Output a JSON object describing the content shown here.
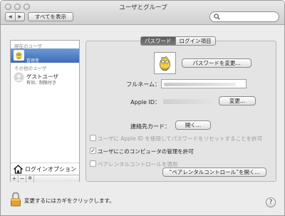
{
  "window": {
    "title": "ユーザとグループ"
  },
  "toolbar": {
    "back_glyph": "◀",
    "forward_glyph": "▶",
    "show_all_label": "すべてを表示",
    "search_value": ""
  },
  "sidebar": {
    "current_users_header": "現在のユーザ",
    "current_user": {
      "name": "",
      "role": "管理者"
    },
    "other_users_header": "その他のユーザ",
    "guest_user": {
      "name": "ゲストユーザ",
      "status": "有効、制限付き"
    },
    "login_options_label": "ログインオプション",
    "add_glyph": "+",
    "remove_glyph": "−",
    "action_glyph": "✲"
  },
  "tabs": [
    {
      "label": "パスワード",
      "active": true
    },
    {
      "label": "ログイン項目",
      "active": false
    }
  ],
  "password_pane": {
    "change_password_label": "パスワードを変更...",
    "full_name_label": "フルネーム：",
    "full_name_value": "",
    "apple_id_label": "Apple ID：",
    "apple_id_value": "",
    "apple_id_change_label": "変更...",
    "contact_card_label": "連絡先カード：",
    "contact_card_open_label": "開く...",
    "options": [
      {
        "label": "ユーザに Apple ID を使用してパスワードをリセットすることを許可",
        "checked": false,
        "enabled": false
      },
      {
        "label": "ユーザにこのコンピュータの管理を許可",
        "checked": true,
        "enabled": false
      },
      {
        "label": "ペアレンタルコントロールを適用",
        "checked": false,
        "enabled": false
      }
    ],
    "open_parental_label": "“ペアレンタルコントロール”を開く..."
  },
  "footer": {
    "lock_text": "変更するにはカギをクリックします。",
    "help_glyph": "?"
  },
  "colors": {
    "selection": "#3d6db5",
    "window_bg": "#ececec",
    "pane_bg": "#e4e4e4"
  }
}
